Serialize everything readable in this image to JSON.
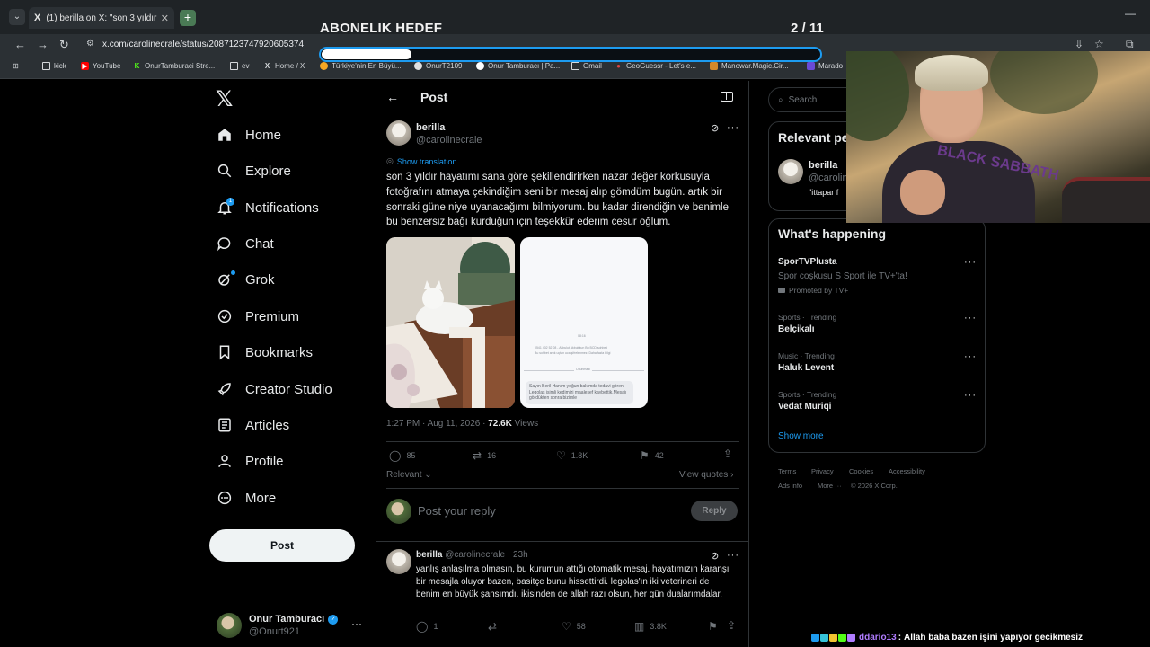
{
  "browser": {
    "tab_title": "(1) berilla on X: \"son 3 yıldır ha...",
    "tab_favicon": "X",
    "url": "x.com/carolinecrale/status/2087123747920605374",
    "bookmarks": [
      {
        "label": "kick",
        "icon": "folder-icon"
      },
      {
        "label": "YouTube",
        "icon": "youtube-icon"
      },
      {
        "label": "OnurTamburaci Stre...",
        "icon": "kick-icon"
      },
      {
        "label": "ev",
        "icon": "folder-icon"
      },
      {
        "label": "Home / X",
        "icon": "x-icon"
      },
      {
        "label": "Türkiye'nin En Büyü...",
        "icon": "site-icon"
      },
      {
        "label": "OnurT2109",
        "icon": "github-icon"
      },
      {
        "label": "Onur Tamburacı | Pa...",
        "icon": "site-icon"
      },
      {
        "label": "Gmail",
        "icon": "folder-icon"
      },
      {
        "label": "GeoGuessr - Let's e...",
        "icon": "pin-icon"
      },
      {
        "label": "Manowar.Magic.Cir...",
        "icon": "site-icon"
      },
      {
        "label": "Marado",
        "icon": "site-icon"
      }
    ]
  },
  "overlay": {
    "title": "ABONELIK HEDEF",
    "count": "2 / 11",
    "progress": 0.18
  },
  "nav": {
    "items": [
      {
        "label": "Home",
        "icon": "home-icon"
      },
      {
        "label": "Explore",
        "icon": "search-icon"
      },
      {
        "label": "Notifications",
        "icon": "bell-icon"
      },
      {
        "label": "Chat",
        "icon": "chat-icon"
      },
      {
        "label": "Grok",
        "icon": "grok-icon"
      },
      {
        "label": "Premium",
        "icon": "premium-icon"
      },
      {
        "label": "Bookmarks",
        "icon": "bookmark-icon"
      },
      {
        "label": "Creator Studio",
        "icon": "rocket-icon"
      },
      {
        "label": "Articles",
        "icon": "article-icon"
      },
      {
        "label": "Profile",
        "icon": "person-icon"
      },
      {
        "label": "More",
        "icon": "more-circle-icon"
      }
    ],
    "notif_badge": "1",
    "post_button": "Post",
    "account": {
      "name": "Onur Tamburacı",
      "handle": "@Onurt921"
    }
  },
  "post": {
    "header": "Post",
    "author": {
      "name": "berilla",
      "handle": "@carolinecrale"
    },
    "show_translation": "Show translation",
    "text": "son 3 yıldır hayatımı sana göre şekillendirirken nazar değer korkusuyla fotoğrafını atmaya çekindiğim seni bir mesaj alıp gömdüm bugün. artık bir sonraki güne niye uyanacağımı bilmiyorum. bu kadar direndiğin ve benimle bu benzersiz bağı kurduğun için teşekkür ederim cesur oğlum.",
    "doc_image": {
      "date": "08:16",
      "line1": "0541 402 52 08 - Akbulut Akbulutun Bu BCD sohbeti",
      "line2": "Bu sohbet artık uçtan uca şifrelenmez. Daha fazla bilgi",
      "separator": "Okunmadı",
      "message": "Sayın Beril Hanım yoğun bakımda tedavi gören Legolas isimli kedimizi maalesef kaybettik.Mesajı gördükten sonra bizimle"
    },
    "time": "1:27 PM · Aug 11, 2026 · ",
    "views_count": "72.6K",
    "views_label": " Views",
    "stats": {
      "replies": "85",
      "reposts": "16",
      "likes": "1.8K",
      "bookmarks": "42"
    },
    "relevant": "Relevant",
    "view_quotes": "View quotes",
    "reply_placeholder": "Post your reply",
    "reply_button": "Reply"
  },
  "reply": {
    "name": "berilla",
    "handle": "@carolinecrale",
    "time": "· 23h",
    "text": "yanlış anlaşılma olmasın, bu kurumun attığı otomatik mesaj. hayatımızın karanşı bir mesajla oluyor bazen, basitçe bunu hissettirdi. legolas'ın iki veterineri de benim en büyük şansımdı. ikisinden de allah razı olsun, her gün dualarımdalar.",
    "stats": {
      "replies": "1",
      "reposts": "",
      "likes": "58",
      "views": "3.8K"
    }
  },
  "right": {
    "search_placeholder": "Search",
    "relevant_title": "Relevant people",
    "relevant_person": {
      "name": "berilla",
      "handle": "@carolinecrale",
      "quote": "\"ittapar f"
    },
    "happening_title": "What's happening",
    "trends": [
      {
        "top": "",
        "name": "SporTVPlusta",
        "sub": "Spor coşkusu S Sport ile TV+'ta!",
        "promo": "Promoted by TV+"
      },
      {
        "top": "Sports · Trending",
        "name": "Belçikalı",
        "sub": "",
        "promo": ""
      },
      {
        "top": "Music · Trending",
        "name": "Haluk Levent",
        "sub": "",
        "promo": ""
      },
      {
        "top": "Sports · Trending",
        "name": "Vedat Muriqi",
        "sub": "",
        "promo": ""
      }
    ],
    "show_more": "Show more",
    "footer": [
      "Terms",
      "Privacy",
      "Cookies",
      "Accessibility",
      "Ads info",
      "More ···",
      "© 2026 X Corp."
    ]
  },
  "webcam": {
    "shirt_text": "BLACK SABBATH"
  },
  "chat": {
    "user": "ddario13",
    "separator": ":",
    "message": "Allah baba bazen işini yapıyor gecikmesiz"
  },
  "colors": {
    "accent": "#1d9bf0",
    "background": "#000000",
    "text": "#e7e9ea",
    "muted": "#71767b",
    "chat_user": "#b07cff"
  }
}
